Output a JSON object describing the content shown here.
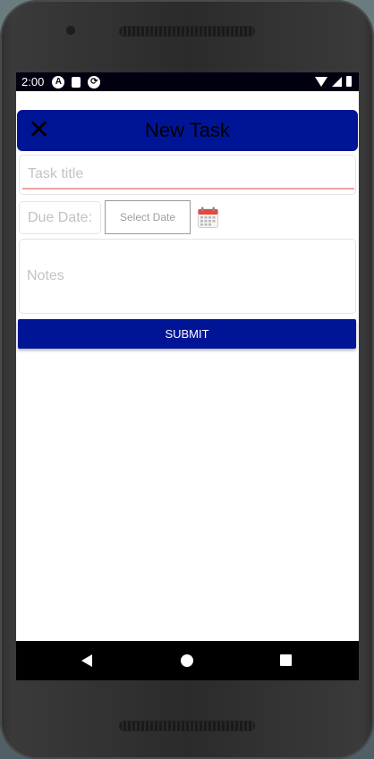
{
  "status_bar": {
    "time": "2:00",
    "icons": [
      "android-icon",
      "sd-card-icon",
      "sync-icon",
      "wifi-icon",
      "signal-icon",
      "battery-icon"
    ]
  },
  "header": {
    "title": "New Task",
    "close_icon": "close-icon",
    "background_color": "#001596"
  },
  "form": {
    "title_placeholder": "Task title",
    "title_value": "",
    "due_date_label": "Due Date:",
    "select_date_label": "Select Date",
    "calendar_icon": "calendar-icon",
    "notes_placeholder": "Notes",
    "notes_value": "",
    "submit_label": "SUBMIT"
  },
  "nav_bar": {
    "back_icon": "back-icon",
    "home_icon": "home-icon",
    "recents_icon": "recents-icon"
  },
  "colors": {
    "accent": "#001596",
    "underline_error": "#f0a4a4"
  }
}
